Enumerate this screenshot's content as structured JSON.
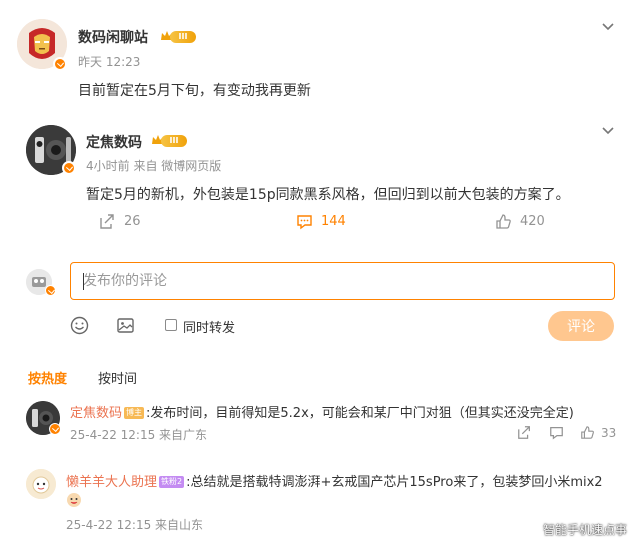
{
  "post": {
    "author": "数码闲聊站",
    "rank_badge": "III",
    "time": "昨天 12:23",
    "content": "目前暂定在5月下旬，有变动我再更新"
  },
  "quoted": {
    "author": "定焦数码",
    "rank_badge": "III",
    "meta": "4小时前  来自 微博网页版",
    "content": "暂定5月的新机，外包装是15p同款黑系风格，但回归到以前大包装的方案了。",
    "reposts": "26",
    "comments": "144",
    "likes": "420"
  },
  "composer": {
    "placeholder": "发布你的评论",
    "repost_label": "同时转发",
    "submit_label": "评论"
  },
  "sort": {
    "hot": "按热度",
    "time": "按时间"
  },
  "comments": [
    {
      "author": "定焦数码",
      "tag": "博主",
      "text": ":发布时间，目前得知是5.2x，可能会和某厂中门对狙（但其实还没完全定)",
      "meta": "25-4-22 12:15  来自广东",
      "likes": "33"
    },
    {
      "author": "懒羊羊大人助理",
      "tag": "铁粉2",
      "text": ":总结就是搭载特调澎湃+玄戒国产芯片15sPro来了，包装梦回小米mix2",
      "meta": "25-4-22 12:15  来自山东"
    }
  ],
  "watermark": "智能手机速点事",
  "colors": {
    "accent": "#ff8200",
    "submit_disabled": "#ffc78f",
    "reply_name": "#eb7350",
    "meta": "#939393"
  }
}
